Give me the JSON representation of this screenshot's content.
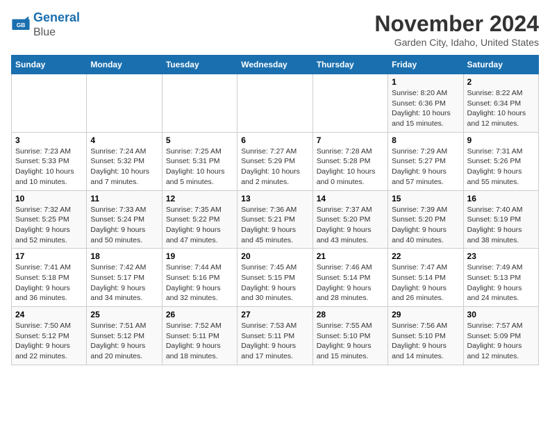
{
  "header": {
    "logo_line1": "General",
    "logo_line2": "Blue",
    "month": "November 2024",
    "location": "Garden City, Idaho, United States"
  },
  "weekdays": [
    "Sunday",
    "Monday",
    "Tuesday",
    "Wednesday",
    "Thursday",
    "Friday",
    "Saturday"
  ],
  "weeks": [
    [
      {
        "day": "",
        "info": ""
      },
      {
        "day": "",
        "info": ""
      },
      {
        "day": "",
        "info": ""
      },
      {
        "day": "",
        "info": ""
      },
      {
        "day": "",
        "info": ""
      },
      {
        "day": "1",
        "info": "Sunrise: 8:20 AM\nSunset: 6:36 PM\nDaylight: 10 hours and 15 minutes."
      },
      {
        "day": "2",
        "info": "Sunrise: 8:22 AM\nSunset: 6:34 PM\nDaylight: 10 hours and 12 minutes."
      }
    ],
    [
      {
        "day": "3",
        "info": "Sunrise: 7:23 AM\nSunset: 5:33 PM\nDaylight: 10 hours and 10 minutes."
      },
      {
        "day": "4",
        "info": "Sunrise: 7:24 AM\nSunset: 5:32 PM\nDaylight: 10 hours and 7 minutes."
      },
      {
        "day": "5",
        "info": "Sunrise: 7:25 AM\nSunset: 5:31 PM\nDaylight: 10 hours and 5 minutes."
      },
      {
        "day": "6",
        "info": "Sunrise: 7:27 AM\nSunset: 5:29 PM\nDaylight: 10 hours and 2 minutes."
      },
      {
        "day": "7",
        "info": "Sunrise: 7:28 AM\nSunset: 5:28 PM\nDaylight: 10 hours and 0 minutes."
      },
      {
        "day": "8",
        "info": "Sunrise: 7:29 AM\nSunset: 5:27 PM\nDaylight: 9 hours and 57 minutes."
      },
      {
        "day": "9",
        "info": "Sunrise: 7:31 AM\nSunset: 5:26 PM\nDaylight: 9 hours and 55 minutes."
      }
    ],
    [
      {
        "day": "10",
        "info": "Sunrise: 7:32 AM\nSunset: 5:25 PM\nDaylight: 9 hours and 52 minutes."
      },
      {
        "day": "11",
        "info": "Sunrise: 7:33 AM\nSunset: 5:24 PM\nDaylight: 9 hours and 50 minutes."
      },
      {
        "day": "12",
        "info": "Sunrise: 7:35 AM\nSunset: 5:22 PM\nDaylight: 9 hours and 47 minutes."
      },
      {
        "day": "13",
        "info": "Sunrise: 7:36 AM\nSunset: 5:21 PM\nDaylight: 9 hours and 45 minutes."
      },
      {
        "day": "14",
        "info": "Sunrise: 7:37 AM\nSunset: 5:20 PM\nDaylight: 9 hours and 43 minutes."
      },
      {
        "day": "15",
        "info": "Sunrise: 7:39 AM\nSunset: 5:20 PM\nDaylight: 9 hours and 40 minutes."
      },
      {
        "day": "16",
        "info": "Sunrise: 7:40 AM\nSunset: 5:19 PM\nDaylight: 9 hours and 38 minutes."
      }
    ],
    [
      {
        "day": "17",
        "info": "Sunrise: 7:41 AM\nSunset: 5:18 PM\nDaylight: 9 hours and 36 minutes."
      },
      {
        "day": "18",
        "info": "Sunrise: 7:42 AM\nSunset: 5:17 PM\nDaylight: 9 hours and 34 minutes."
      },
      {
        "day": "19",
        "info": "Sunrise: 7:44 AM\nSunset: 5:16 PM\nDaylight: 9 hours and 32 minutes."
      },
      {
        "day": "20",
        "info": "Sunrise: 7:45 AM\nSunset: 5:15 PM\nDaylight: 9 hours and 30 minutes."
      },
      {
        "day": "21",
        "info": "Sunrise: 7:46 AM\nSunset: 5:14 PM\nDaylight: 9 hours and 28 minutes."
      },
      {
        "day": "22",
        "info": "Sunrise: 7:47 AM\nSunset: 5:14 PM\nDaylight: 9 hours and 26 minutes."
      },
      {
        "day": "23",
        "info": "Sunrise: 7:49 AM\nSunset: 5:13 PM\nDaylight: 9 hours and 24 minutes."
      }
    ],
    [
      {
        "day": "24",
        "info": "Sunrise: 7:50 AM\nSunset: 5:12 PM\nDaylight: 9 hours and 22 minutes."
      },
      {
        "day": "25",
        "info": "Sunrise: 7:51 AM\nSunset: 5:12 PM\nDaylight: 9 hours and 20 minutes."
      },
      {
        "day": "26",
        "info": "Sunrise: 7:52 AM\nSunset: 5:11 PM\nDaylight: 9 hours and 18 minutes."
      },
      {
        "day": "27",
        "info": "Sunrise: 7:53 AM\nSunset: 5:11 PM\nDaylight: 9 hours and 17 minutes."
      },
      {
        "day": "28",
        "info": "Sunrise: 7:55 AM\nSunset: 5:10 PM\nDaylight: 9 hours and 15 minutes."
      },
      {
        "day": "29",
        "info": "Sunrise: 7:56 AM\nSunset: 5:10 PM\nDaylight: 9 hours and 14 minutes."
      },
      {
        "day": "30",
        "info": "Sunrise: 7:57 AM\nSunset: 5:09 PM\nDaylight: 9 hours and 12 minutes."
      }
    ]
  ]
}
